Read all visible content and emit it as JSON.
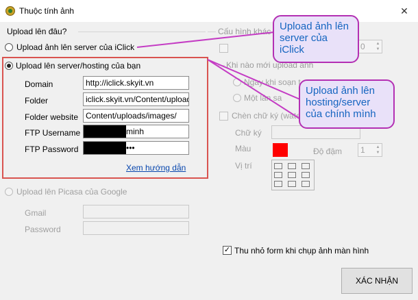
{
  "window": {
    "title": "Thuộc tính ảnh",
    "close_label": "✕"
  },
  "upload_section": {
    "label": "Upload lên đâu?",
    "option_iclick": "Upload ảnh lên server của iClick",
    "option_hosting": "Upload lên server/hosting của bạn",
    "fields": {
      "domain_label": "Domain",
      "domain_value": "http://iclick.skyit.vn",
      "folder_label": "Folder",
      "folder_value": "iclick.skyit.vn/Content/uploads/",
      "folder_website_label": "Folder website",
      "folder_website_value": "Content/uploads/images/",
      "ftp_username_label": "FTP Username",
      "ftp_username_value": "minh",
      "ftp_password_label": "FTP Password",
      "ftp_password_value": "•••"
    },
    "guide_link": "Xem hướng dẫn",
    "option_picasa": "Upload lên Picasa của Google",
    "gmail_label": "Gmail",
    "password_label": "Password"
  },
  "config_section": {
    "label": "Cấu hình khác",
    "spin1_value": "0",
    "when_label": "Khi nào mới upload ảnh",
    "when_option1": "Ngay khi soạn t",
    "when_option2": "Một lần sa",
    "signature_check": "Chèn chữ ký (wate",
    "signature_label": "Chữ ký",
    "color_label": "Màu",
    "color_value": "#ff0000",
    "density_label": "Độ đậm",
    "density_value": "1",
    "position_label": "Vị trí"
  },
  "shrink_form_check": "Thu nhỏ form khi chụp ảnh màn hình",
  "confirm_button": "XÁC NHẬN",
  "callouts": {
    "iclick": "Upload ảnh lên server của iClick",
    "hosting": "Upload ảnh lên hosting/server của chính mình"
  }
}
